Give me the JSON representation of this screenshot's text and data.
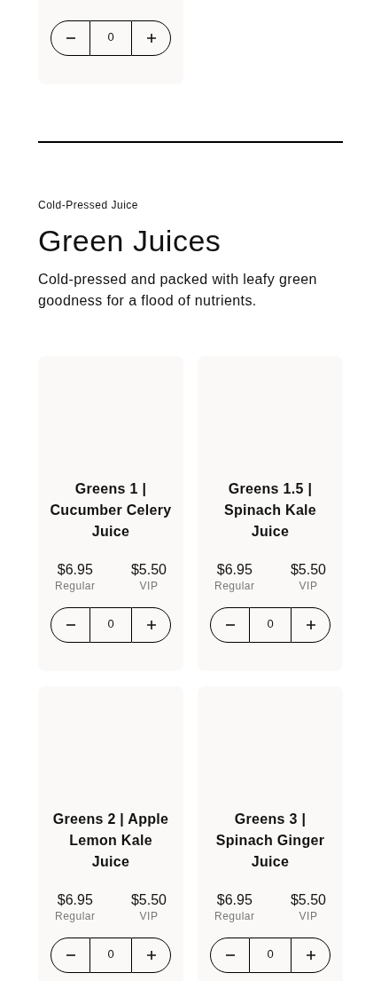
{
  "previous_card": {
    "quantity": "0"
  },
  "section": {
    "eyebrow": "Cold-Pressed Juice",
    "title": "Green Juices",
    "description": "Cold-pressed and packed with leafy green goodness for a flood of nutrients."
  },
  "products": [
    {
      "name": "Greens 1 | Cucumber Celery Juice",
      "regular_price": "$6.95",
      "regular_label": "Regular",
      "vip_price": "$5.50",
      "vip_label": "VIP",
      "quantity": "0"
    },
    {
      "name": "Greens 1.5 | Spinach Kale Juice",
      "regular_price": "$6.95",
      "regular_label": "Regular",
      "vip_price": "$5.50",
      "vip_label": "VIP",
      "quantity": "0"
    },
    {
      "name": "Greens 2 | Apple Lemon Kale Juice",
      "regular_price": "$6.95",
      "regular_label": "Regular",
      "vip_price": "$5.50",
      "vip_label": "VIP",
      "quantity": "0"
    },
    {
      "name": "Greens 3 | Spinach Ginger Juice",
      "regular_price": "$6.95",
      "regular_label": "Regular",
      "vip_price": "$5.50",
      "vip_label": "VIP",
      "quantity": "0"
    }
  ]
}
